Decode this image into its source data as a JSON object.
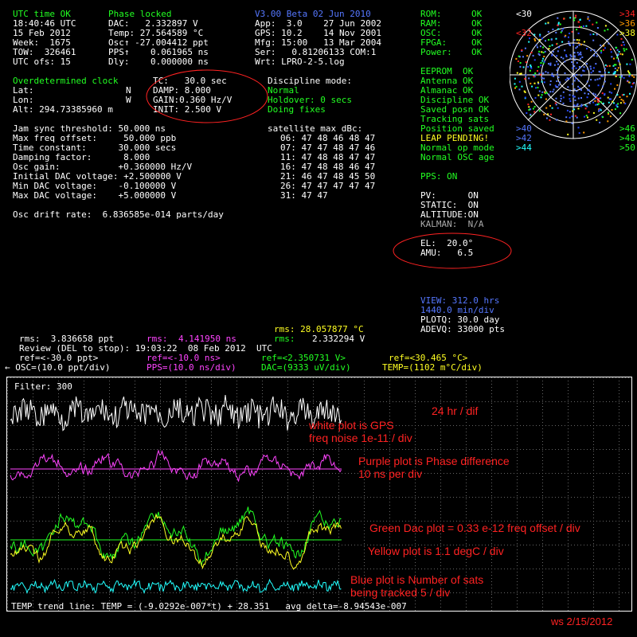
{
  "left_status": {
    "header_a": "UTC time OK",
    "header_b": "Phase locked",
    "rows": [
      [
        "18:40:46 UTC",
        "DAC:   2.332897 V"
      ],
      [
        "15 Feb 2012",
        "Temp: 27.564589 °C"
      ],
      [
        "Week:  1675",
        "Osc↑ -27.004412 ppt"
      ],
      [
        "TOW:  326461",
        "PPS↑    0.061965 ns"
      ],
      [
        "UTC ofs: 15",
        "Dly:    0.000000 ns"
      ]
    ]
  },
  "receiver_info": {
    "version": "V3.00 Beta 02 Jun 2010",
    "rows": [
      "App:  3.0    27 Jun 2002",
      "GPS: 10.2    14 Nov 2001",
      "Mfg: 15:00   13 Mar 2004",
      "Ser:   0.81206133 COM:1",
      "Wrt: LPRO-2-5.log"
    ]
  },
  "status_flags": {
    "rows": [
      {
        "label": "ROM:",
        "value": "OK"
      },
      {
        "label": "RAM:",
        "value": "OK"
      },
      {
        "label": "OSC:",
        "value": "OK"
      },
      {
        "label": "FPGA:",
        "value": "OK"
      },
      {
        "label": "Power:",
        "value": "OK"
      }
    ],
    "list": [
      {
        "text": "EEPROM  OK",
        "color": "#22ff22"
      },
      {
        "text": "Antenna OK",
        "color": "#22ff22"
      },
      {
        "text": "Almanac OK",
        "color": "#22ff22"
      },
      {
        "text": "Discipline OK",
        "color": "#22ff22"
      },
      {
        "text": "Saved posn OK",
        "color": "#22ff22"
      },
      {
        "text": "Tracking sats",
        "color": "#22ff22"
      },
      {
        "text": "Position saved",
        "color": "#22ff22"
      },
      {
        "text": "LEAP PENDING!",
        "color": "#ffff22"
      },
      {
        "text": "Normal op mode",
        "color": "#22ff22"
      },
      {
        "text": "Normal OSC age",
        "color": "#22ff22"
      }
    ],
    "pps": "PPS: ON"
  },
  "sky_labels": {
    "lt30": "<30",
    "lt32": "<32",
    "gt34": ">34",
    "gt36": ">36",
    "gt38": ">38",
    "gt40": ">40",
    "gt42": ">42",
    "gt44": ">44",
    "gt46": ">46",
    "gt48": ">48",
    "gt50": ">50"
  },
  "clock": {
    "title": "Overdetermined clock",
    "lat": "Lat:",
    "lat_dir": "N",
    "lon": "Lon:",
    "lon_dir": "W",
    "alt": "Alt: 294.73385960 m",
    "tc": "TC:   30.0 sec",
    "damp": "DAMP: 8.000",
    "gain": "GAIN:0.360 Hz/V",
    "init": "INIT: 2.500 V"
  },
  "discipline": {
    "title": "Discipline mode:",
    "mode": "Normal",
    "holdover": "Holdover: 0 secs",
    "doing": "Doing fixes"
  },
  "params": [
    "Jam sync threshold: 50.000 ns",
    "Max freq offset:     50.000 ppb",
    "Time constant:      30.000 secs",
    "Damping factor:      8.000",
    "Osc gain:           +0.360000 Hz/V",
    "Initial DAC voltage: +2.500000 V",
    "Min DAC voltage:    -0.100000 V",
    "Max DAC voltage:    +5.000000 V"
  ],
  "drift": "Osc drift rate:  6.836585e-014 parts/day",
  "sat_table": {
    "title": "satellite max dBc:",
    "rows": [
      "06: 47 48 46 48 47",
      "07: 47 47 48 47 46",
      "11: 47 48 48 47 47",
      "16: 47 48 48 46 47",
      "21: 46 47 48 45 50",
      "26: 47 47 47 47 47",
      "31: 47 47"
    ]
  },
  "modes": {
    "pv": "PV:      ON",
    "static": "STATIC:  ON",
    "altitude": "ALTITUDE:ON",
    "kalman": "KALMAN:  N/A",
    "el": "EL:  20.0°",
    "amu": "AMU:   6.5"
  },
  "view": {
    "view": "VIEW: 312.0 hrs",
    "per_div": "1440.0 min/div",
    "plotq": "PLOTQ: 30.0 day",
    "adevq": "ADEVQ: 33000 pts"
  },
  "stats": {
    "rms_temp": "rms: 28.057877 °C",
    "rms_osc": "rms:  3.836658 ppt",
    "rms_pps_label": "rms:",
    "rms_pps_value": "4.141950 ns",
    "rms_dac_label": "rms:",
    "rms_dac_value": "2.332294 V",
    "review": "Review (DEL to stop): 19:03:22  08 Feb 2012  UTC"
  },
  "refs": {
    "osc_ref": "ref=<-30.0 ppt>",
    "pps_ref": "ref=<-10.0 ns>",
    "dac_ref": "ref=<2.350731 V>",
    "temp_ref": "ref=<30.465 °C>",
    "osc_scale": "← OSC=(10.0 ppt/div)",
    "pps_scale": "PPS=(10.0 ns/div)",
    "dac_scale": "DAC=(9333 uV/div)",
    "temp_scale": "TEMP=(1102 m°C/div)"
  },
  "plot": {
    "filter": "Filter: 300",
    "trend": "TEMP trend line: TEMP = (-9.0292e-007*t) + 28.351   avg delta=-8.94543e-007"
  },
  "annotations": {
    "hr_div": "24 hr / dif",
    "white": "white plot is GPS\nfreq noise 1e-11 / div",
    "purple": "Purple plot is Phase difference\n10 ns per div",
    "green": "Green Dac plot = 0.33 e-12 freq offset / div",
    "yellow": "Yellow plot is 1.1 degC / div",
    "blue": "Blue plot is Number of sats\nbeing tracked 5 / div",
    "signature": "ws 2/15/2012"
  },
  "colors": {
    "white": "#ffffff",
    "green": "#22ff22",
    "yellow": "#ffff22",
    "blue": "#5577ff",
    "cyan": "#22ffff",
    "magenta": "#ff44ff",
    "red": "#ff2222"
  }
}
